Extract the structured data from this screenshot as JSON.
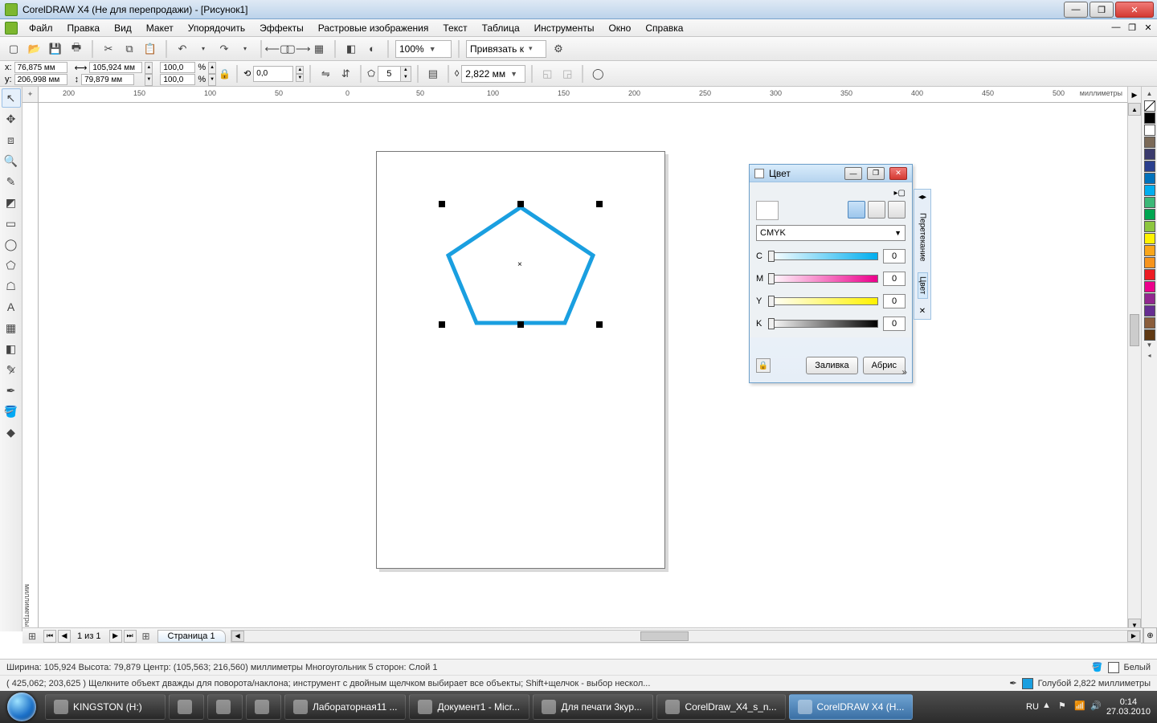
{
  "window": {
    "title": "CorelDRAW X4 (Не для перепродажи) - [Рисунок1]"
  },
  "menu": {
    "items": [
      "Файл",
      "Правка",
      "Вид",
      "Макет",
      "Упорядочить",
      "Эффекты",
      "Растровые изображения",
      "Текст",
      "Таблица",
      "Инструменты",
      "Окно",
      "Справка"
    ]
  },
  "toolbar": {
    "zoom": "100%",
    "snap_label": "Привязать к"
  },
  "propbar": {
    "x_label": "x:",
    "x": "76,875 мм",
    "y_label": "y:",
    "y": "206,998 мм",
    "w": "105,924 мм",
    "h": "79,879 мм",
    "scale_x": "100,0",
    "scale_y": "100,0",
    "rotation": "0,0",
    "sides": "5",
    "outline_width": "2,822 мм"
  },
  "ruler": {
    "units": "миллиметры",
    "h_ticks": [
      "200",
      "150",
      "100",
      "50",
      "0",
      "50",
      "100",
      "150",
      "200",
      "250",
      "300",
      "350",
      "400",
      "450",
      "500"
    ]
  },
  "pagenav": {
    "counter": "1 из 1",
    "tab": "Страница 1"
  },
  "docker": {
    "title": "Цвет",
    "model": "CMYK",
    "channels": [
      {
        "label": "C",
        "value": "0",
        "grad": "linear-gradient(90deg,#fff,#00aeef)"
      },
      {
        "label": "M",
        "value": "0",
        "grad": "linear-gradient(90deg,#fff,#ec008c)"
      },
      {
        "label": "Y",
        "value": "0",
        "grad": "linear-gradient(90deg,#fff,#fff200)"
      },
      {
        "label": "K",
        "value": "0",
        "grad": "linear-gradient(90deg,#fff,#000)"
      }
    ],
    "fill_btn": "Заливка",
    "outline_btn": "Абрис",
    "side_tab1": "Перетекание",
    "side_tab2": "Цвет"
  },
  "palette_colors": [
    "none",
    "#000000",
    "#ffffff",
    "#7b6a58",
    "#3b3b6d",
    "#2a3f8e",
    "#0072bc",
    "#00aeef",
    "#3cb878",
    "#00a651",
    "#8dc63f",
    "#fff200",
    "#faa61a",
    "#f7941d",
    "#ed1c24",
    "#ec008c",
    "#92278f",
    "#662d91",
    "#8b5e3c",
    "#603913"
  ],
  "status": {
    "line1_left": "Ширина: 105,924 Высота: 79,879 Центр: (105,563; 216,560) миллиметры      Многоугольник  5 сторон: Слой 1",
    "line1_right_label": "Белый",
    "line2_left": "( 425,062; 203,625 )    Щелкните объект дважды для поворота/наклона; инструмент с двойным щелчком выбирает все объекты; Shift+щелчок - выбор нескол...",
    "line2_right_label": "Голубой  2,822 миллиметры"
  },
  "taskbar": {
    "items": [
      {
        "label": "KINGSTON (H:)",
        "active": false
      },
      {
        "label": "",
        "icon_only": true
      },
      {
        "label": "",
        "icon_only": true
      },
      {
        "label": "",
        "icon_only": true
      },
      {
        "label": "Лабораторная11 ...",
        "active": false
      },
      {
        "label": "Документ1 - Micr...",
        "active": false
      },
      {
        "label": "Для печати 3кур...",
        "active": false
      },
      {
        "label": "CorelDraw_X4_s_n...",
        "active": false
      },
      {
        "label": "CorelDRAW X4 (Н...",
        "active": true
      }
    ],
    "lang": "RU",
    "time": "0:14",
    "date": "27.03.2010"
  }
}
